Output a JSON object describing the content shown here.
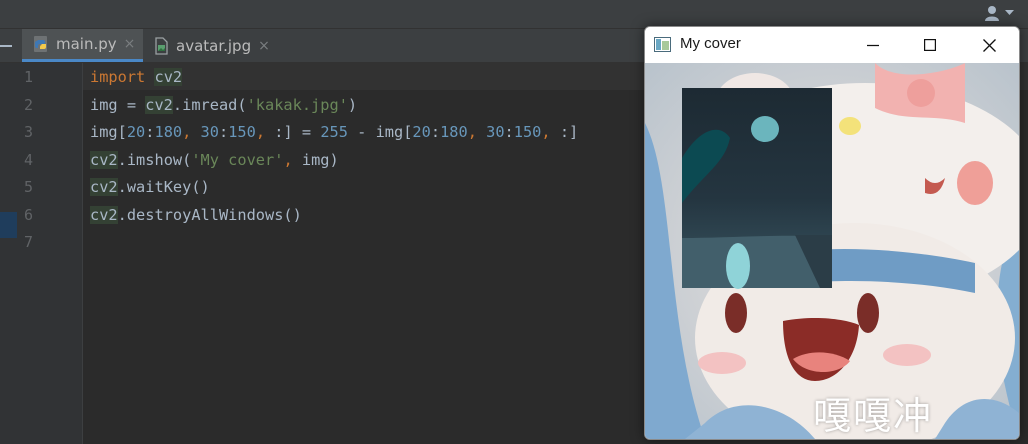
{
  "toolbar": {
    "user_icon": "user-icon",
    "dropdown_icon": "chevron-down-icon"
  },
  "tabs": [
    {
      "label": "main.py",
      "icon": "python-file-icon",
      "close": "×",
      "active": true
    },
    {
      "label": "avatar.jpg",
      "icon": "image-file-icon",
      "close": "×",
      "active": false
    }
  ],
  "editor": {
    "line_numbers": [
      "1",
      "2",
      "3",
      "4",
      "5",
      "6",
      "7"
    ],
    "lines": [
      [
        {
          "t": "import",
          "c": "kw"
        },
        {
          "t": " ",
          "c": ""
        },
        {
          "t": "cv2",
          "c": "hl"
        }
      ],
      [
        {
          "t": "img = ",
          "c": ""
        },
        {
          "t": "cv2",
          "c": "hl"
        },
        {
          "t": ".imread(",
          "c": ""
        },
        {
          "t": "'kakak.jpg'",
          "c": "str"
        },
        {
          "t": ")",
          "c": ""
        }
      ],
      [
        {
          "t": "img[",
          "c": ""
        },
        {
          "t": "20",
          "c": "num"
        },
        {
          "t": ":",
          "c": ""
        },
        {
          "t": "180",
          "c": "num"
        },
        {
          "t": ", ",
          "c": "kw"
        },
        {
          "t": "30",
          "c": "num"
        },
        {
          "t": ":",
          "c": ""
        },
        {
          "t": "150",
          "c": "num"
        },
        {
          "t": ", ",
          "c": "kw"
        },
        {
          "t": ":] = ",
          "c": ""
        },
        {
          "t": "255",
          "c": "num"
        },
        {
          "t": " - img[",
          "c": ""
        },
        {
          "t": "20",
          "c": "num"
        },
        {
          "t": ":",
          "c": ""
        },
        {
          "t": "180",
          "c": "num"
        },
        {
          "t": ", ",
          "c": "kw"
        },
        {
          "t": "30",
          "c": "num"
        },
        {
          "t": ":",
          "c": ""
        },
        {
          "t": "150",
          "c": "num"
        },
        {
          "t": ", ",
          "c": "kw"
        },
        {
          "t": ":]",
          "c": ""
        }
      ],
      [
        {
          "t": "cv2",
          "c": "hl"
        },
        {
          "t": ".imshow(",
          "c": ""
        },
        {
          "t": "'My cover'",
          "c": "str"
        },
        {
          "t": ", ",
          "c": "kw"
        },
        {
          "t": "img)",
          "c": ""
        }
      ],
      [
        {
          "t": "cv2",
          "c": "hl"
        },
        {
          "t": ".waitKey()",
          "c": ""
        }
      ],
      [
        {
          "t": "cv2",
          "c": "hl"
        },
        {
          "t": ".destroyAllWindows()",
          "c": ""
        }
      ],
      []
    ]
  },
  "image_window": {
    "title": "My cover",
    "app_icon": "opencv-window-icon",
    "minimize_icon": "minimize-icon",
    "maximize_icon": "maximize-icon",
    "close_icon": "close-icon",
    "image_caption": "嘎嘎冲"
  },
  "colors": {
    "editor_bg": "#2b2b2b",
    "keyword": "#cc7832",
    "string": "#6a8759",
    "number": "#6897bb",
    "text": "#a9b7c6",
    "active_tab_underline": "#4a88c7"
  }
}
